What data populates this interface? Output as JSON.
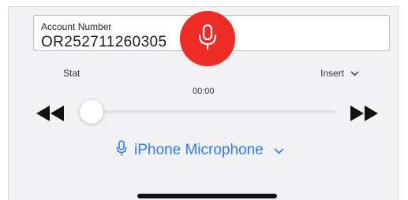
{
  "account": {
    "label": "Account Number",
    "value": "OR252711260305"
  },
  "controls": {
    "stat_label": "Stat",
    "insert_label": "Insert",
    "time": "00:00",
    "progress": 0.0
  },
  "device": {
    "name": "iPhone Microphone"
  },
  "colors": {
    "record": "#ee2b24",
    "accent": "#2f7cf6",
    "background": "#f2f2f4"
  },
  "icons": {
    "record": "microphone-icon",
    "rewind": "rewind-icon",
    "forward": "fast-forward-icon",
    "device": "microphone-icon",
    "dropdown": "chevron-down-icon"
  }
}
